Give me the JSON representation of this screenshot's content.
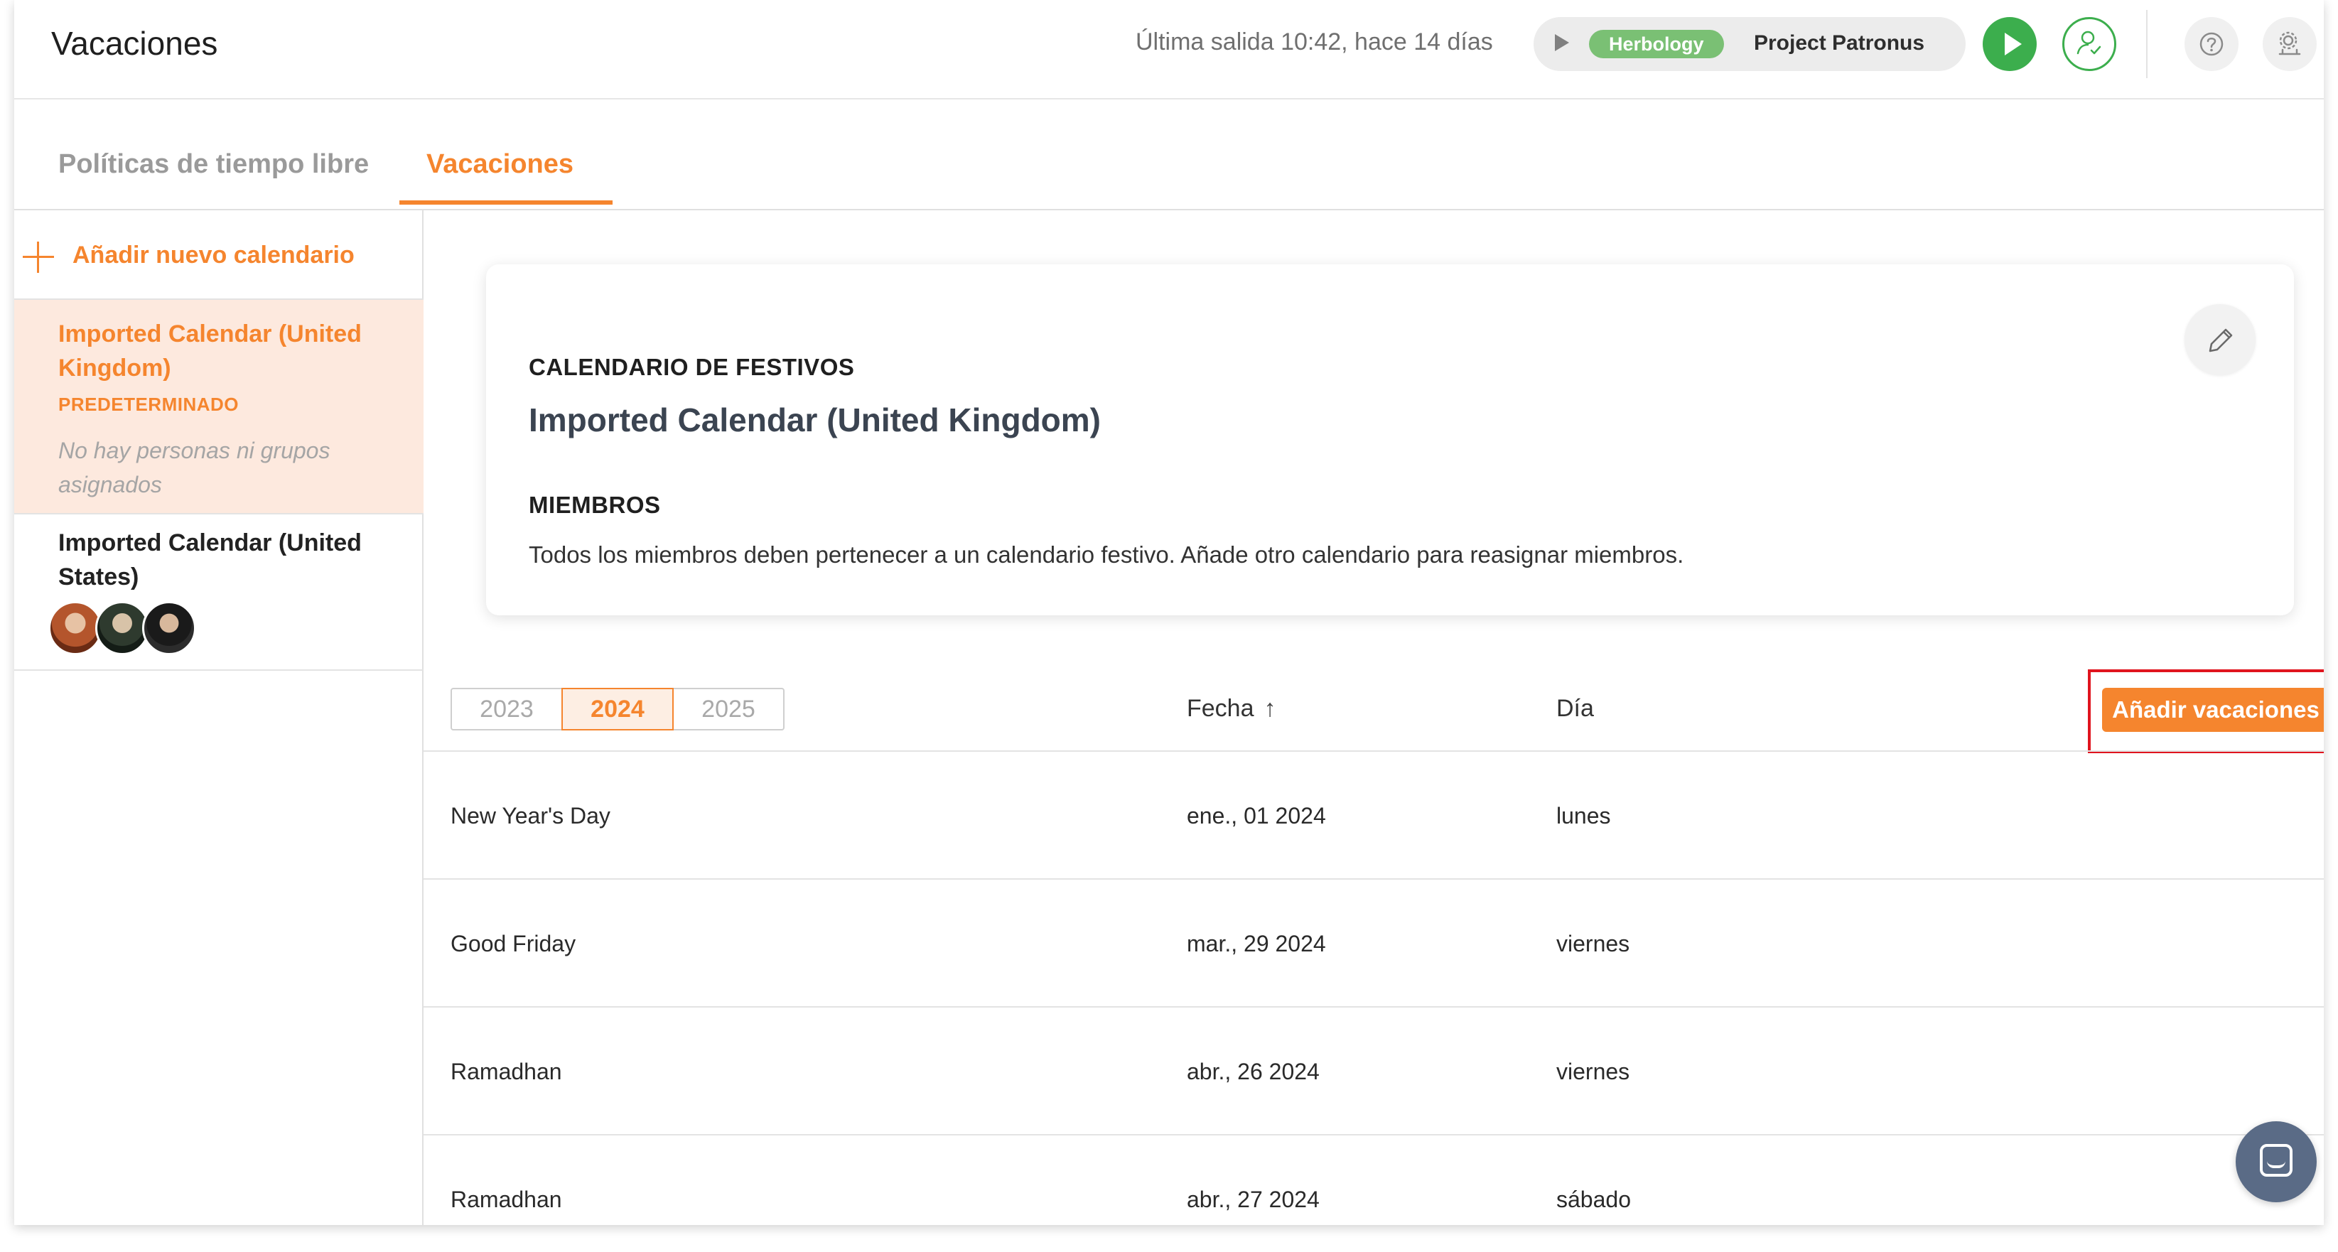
{
  "header": {
    "title": "Vacaciones",
    "last_exit": "Última salida 10:42, hace 14 días",
    "timer": {
      "project_tag": "Herbology",
      "project_name": "Project Patronus"
    }
  },
  "tabs": [
    {
      "label": "Políticas de tiempo libre",
      "active": false
    },
    {
      "label": "Vacaciones",
      "active": true
    }
  ],
  "sidebar": {
    "add_label": "Añadir nuevo calendario",
    "calendars": [
      {
        "name": "Imported Calendar (United Kingdom)",
        "badge": "PREDETERMINADO",
        "members_text": "No hay personas ni grupos asignados",
        "selected": true
      },
      {
        "name": "Imported Calendar (United States)",
        "selected": false
      }
    ]
  },
  "card": {
    "eyebrow": "CALENDARIO DE FESTIVOS",
    "title": "Imported Calendar (United Kingdom)",
    "members_heading": "MIEMBROS",
    "members_text": "Todos los miembros deben pertenecer a un calendario festivo. Añade otro calendario para reasignar miembros."
  },
  "years": [
    "2023",
    "2024",
    "2025"
  ],
  "selected_year": "2024",
  "table": {
    "headers": {
      "date": "Fecha",
      "sort_icon": "↑",
      "day": "Día"
    },
    "add_button": "Añadir vacaciones",
    "rows": [
      {
        "name": "New Year's Day",
        "date": "ene., 01 2024",
        "day": "lunes"
      },
      {
        "name": "Good Friday",
        "date": "mar., 29 2024",
        "day": "viernes"
      },
      {
        "name": "Ramadhan",
        "date": "abr., 26 2024",
        "day": "viernes"
      },
      {
        "name": "Ramadhan",
        "date": "abr., 27 2024",
        "day": "sábado"
      }
    ]
  },
  "colors": {
    "accent": "#f5852e",
    "green": "#3cae4d",
    "highlight": "#e0141e"
  },
  "icons": [
    "play-icon",
    "user-check-icon",
    "help-icon",
    "settings-icon",
    "plus-icon",
    "pencil-icon",
    "sort-up-icon",
    "chat-icon"
  ]
}
